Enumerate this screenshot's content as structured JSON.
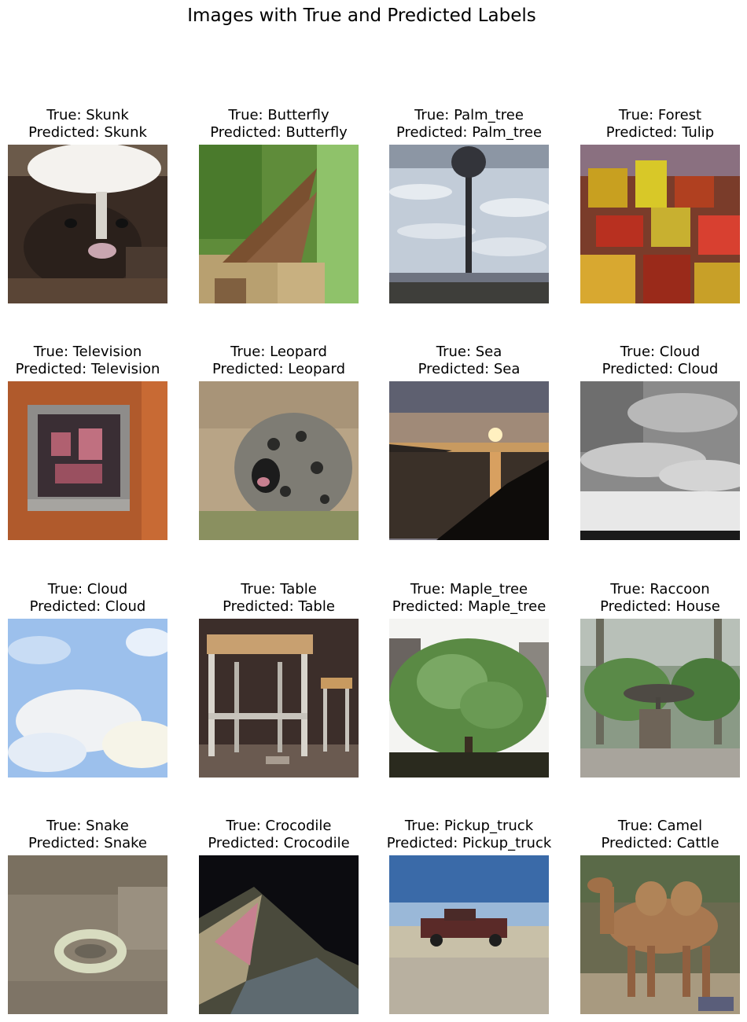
{
  "figure": {
    "title": "Images with True and Predicted Labels"
  },
  "images": [
    {
      "true_label": "True: Skunk",
      "pred_label": "Predicted: Skunk",
      "scene": "skunk"
    },
    {
      "true_label": "True: Butterfly",
      "pred_label": "Predicted: Butterfly",
      "scene": "butterfly"
    },
    {
      "true_label": "True: Palm_tree",
      "pred_label": "Predicted: Palm_tree",
      "scene": "palm"
    },
    {
      "true_label": "True: Forest",
      "pred_label": "Predicted: Tulip",
      "scene": "forest"
    },
    {
      "true_label": "True: Television",
      "pred_label": "Predicted: Television",
      "scene": "tv"
    },
    {
      "true_label": "True: Leopard",
      "pred_label": "Predicted: Leopard",
      "scene": "leopard"
    },
    {
      "true_label": "True: Sea",
      "pred_label": "Predicted: Sea",
      "scene": "sea"
    },
    {
      "true_label": "True: Cloud",
      "pred_label": "Predicted: Cloud",
      "scene": "cloud-gray"
    },
    {
      "true_label": "True: Cloud",
      "pred_label": "Predicted: Cloud",
      "scene": "cloud-blue"
    },
    {
      "true_label": "True: Table",
      "pred_label": "Predicted: Table",
      "scene": "table"
    },
    {
      "true_label": "True: Maple_tree",
      "pred_label": "Predicted: Maple_tree",
      "scene": "maple"
    },
    {
      "true_label": "True: Raccoon",
      "pred_label": "Predicted: House",
      "scene": "raccoon"
    },
    {
      "true_label": "True: Snake",
      "pred_label": "Predicted: Snake",
      "scene": "snake"
    },
    {
      "true_label": "True: Crocodile",
      "pred_label": "Predicted: Crocodile",
      "scene": "crocodile"
    },
    {
      "true_label": "True: Pickup_truck",
      "pred_label": "Predicted: Pickup_truck",
      "scene": "truck"
    },
    {
      "true_label": "True: Camel",
      "pred_label": "Predicted: Cattle",
      "scene": "camel"
    }
  ]
}
